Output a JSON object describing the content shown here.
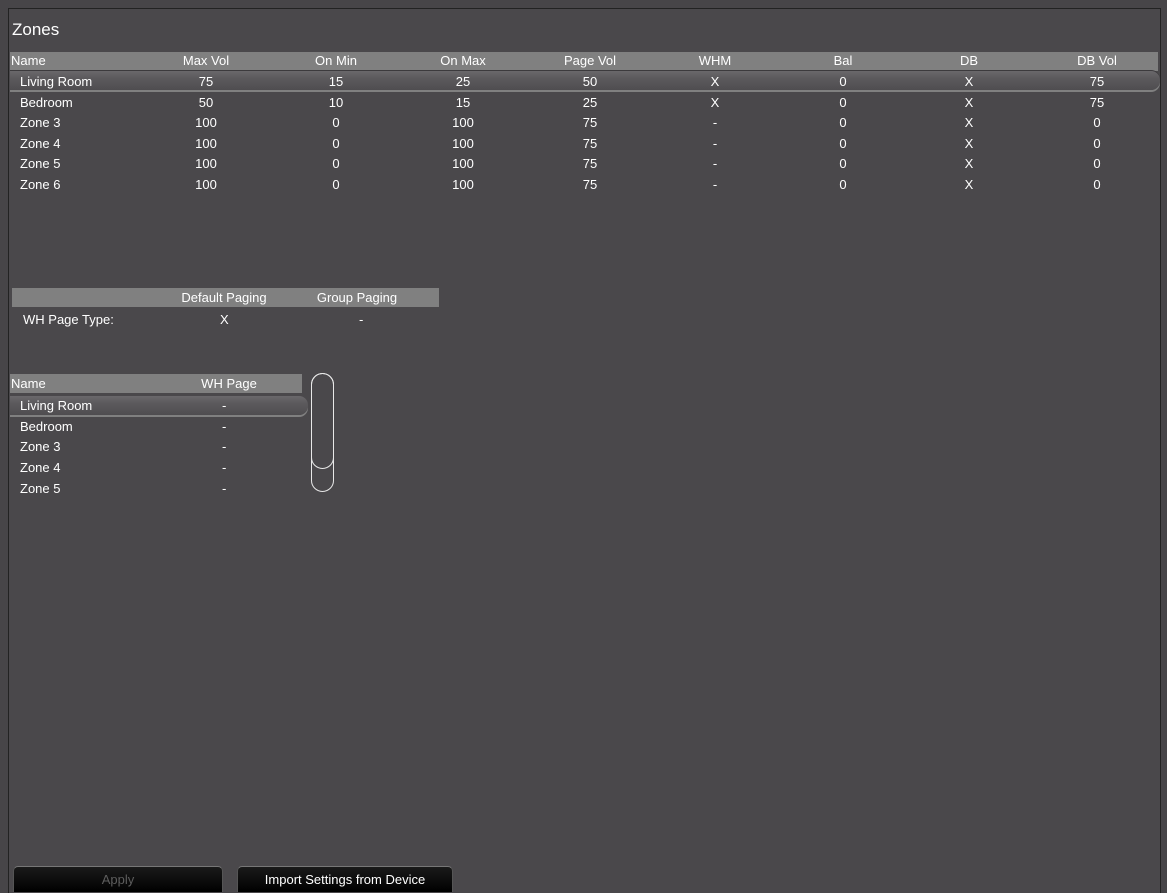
{
  "title": "Zones",
  "zones_table": {
    "headers": [
      "Name",
      "Max Vol",
      "On Min",
      "On Max",
      "Page Vol",
      "WHM",
      "Bal",
      "DB",
      "DB Vol"
    ],
    "rows": [
      [
        "Living Room",
        "75",
        "15",
        "25",
        "50",
        "X",
        "0",
        "X",
        "75"
      ],
      [
        "Bedroom",
        "50",
        "10",
        "15",
        "25",
        "X",
        "0",
        "X",
        "75"
      ],
      [
        "Zone 3",
        "100",
        "0",
        "100",
        "75",
        "-",
        "0",
        "X",
        "0"
      ],
      [
        "Zone 4",
        "100",
        "0",
        "100",
        "75",
        "-",
        "0",
        "X",
        "0"
      ],
      [
        "Zone 5",
        "100",
        "0",
        "100",
        "75",
        "-",
        "0",
        "X",
        "0"
      ],
      [
        "Zone 6",
        "100",
        "0",
        "100",
        "75",
        "-",
        "0",
        "X",
        "0"
      ]
    ],
    "selected_row": 0
  },
  "paging_table": {
    "headers": [
      "",
      "Default Paging",
      "Group Paging"
    ],
    "rows": [
      [
        "WH Page Type:",
        "X",
        "-"
      ]
    ]
  },
  "wh_page_table": {
    "headers": [
      "Name",
      "WH Page"
    ],
    "rows": [
      [
        "Living Room",
        "-"
      ],
      [
        "Bedroom",
        "-"
      ],
      [
        "Zone 3",
        "-"
      ],
      [
        "Zone 4",
        "-"
      ],
      [
        "Zone 5",
        "-"
      ]
    ],
    "selected_row": 0
  },
  "buttons": {
    "apply": "Apply",
    "import": "Import Settings from Device"
  }
}
